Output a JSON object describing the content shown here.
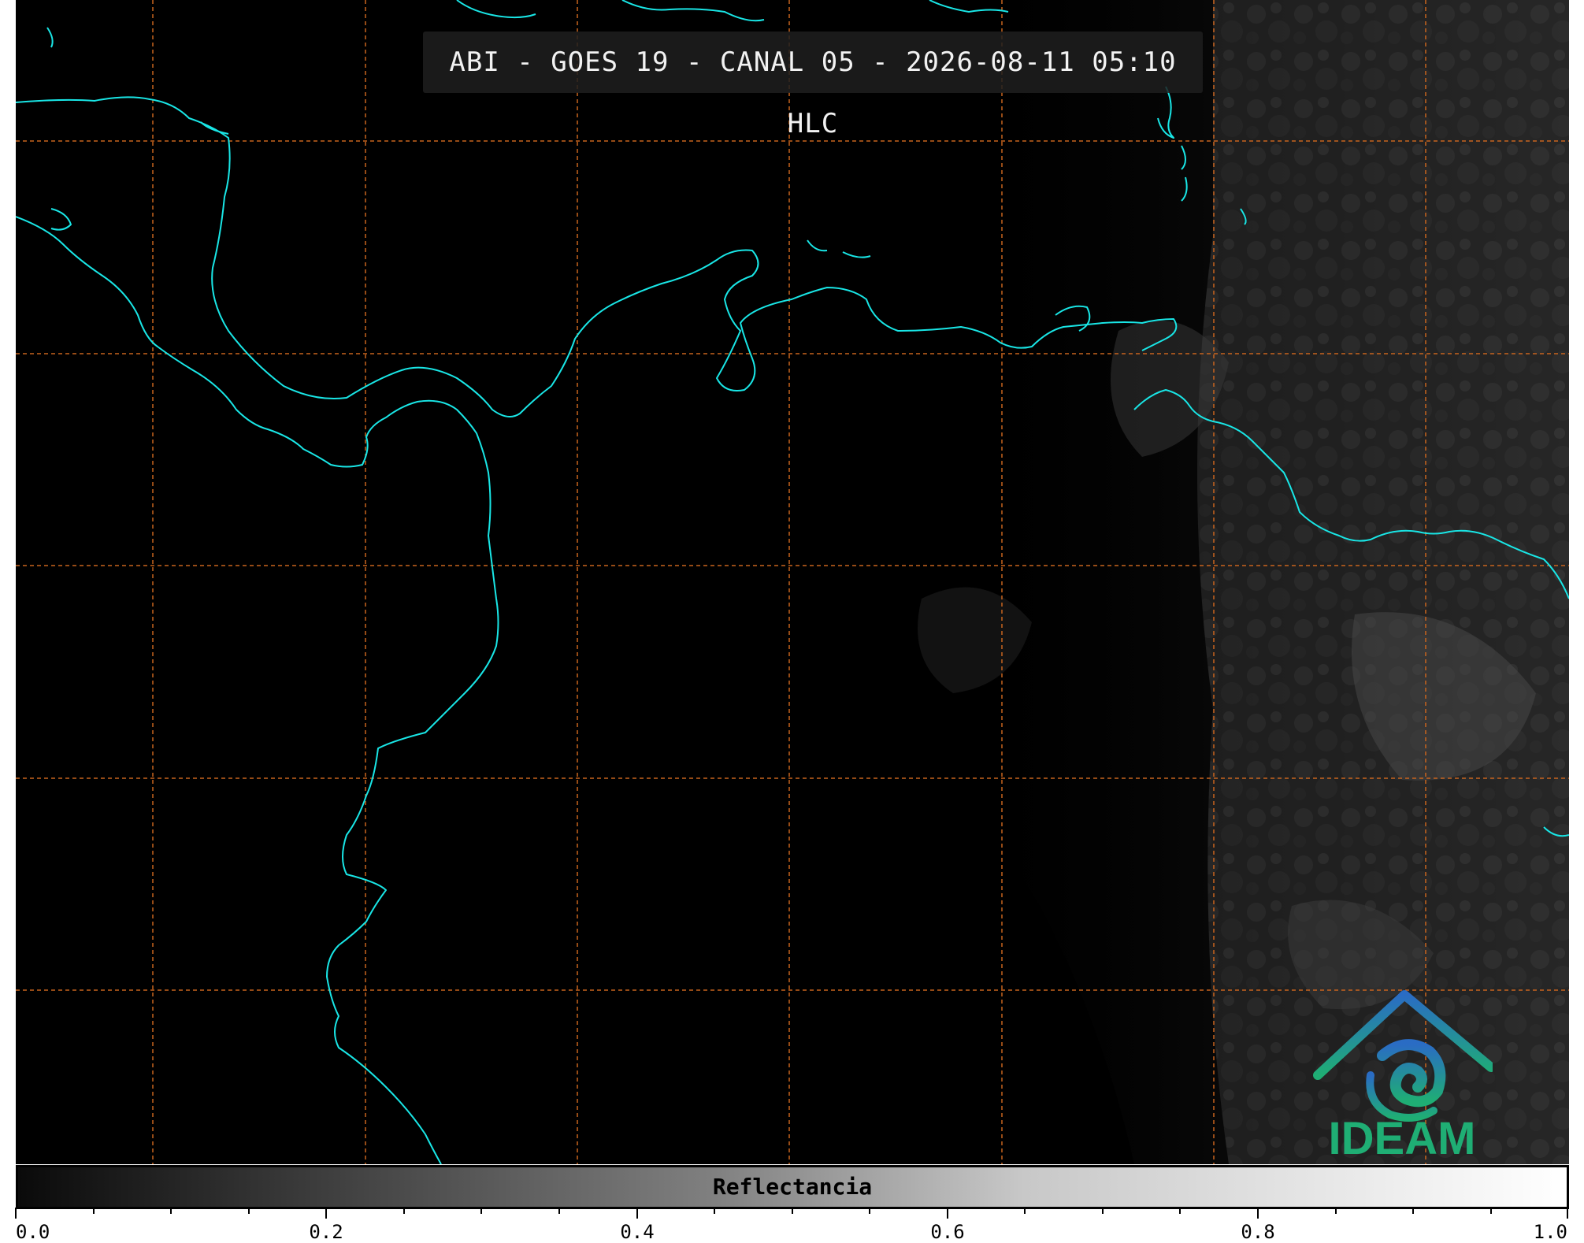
{
  "title": "ABI - GOES 19 - CANAL 05 - 2026-08-11 05:10 HLC",
  "logo": {
    "text": "IDEAM",
    "icon": "ideam-logo-icon"
  },
  "colorbar": {
    "label": "Reflectancia",
    "ticks": [
      "0.0",
      "0.2",
      "0.4",
      "0.6",
      "0.8",
      "1.0"
    ],
    "range": [
      0.0,
      1.0
    ],
    "colormap": "grayscale"
  },
  "colors": {
    "coastline": "#19e6e6",
    "grid": "#c8641e",
    "title_box": "#1e1e1e",
    "logo_green": "#1fae74",
    "logo_blue": "#2a6cc4"
  }
}
